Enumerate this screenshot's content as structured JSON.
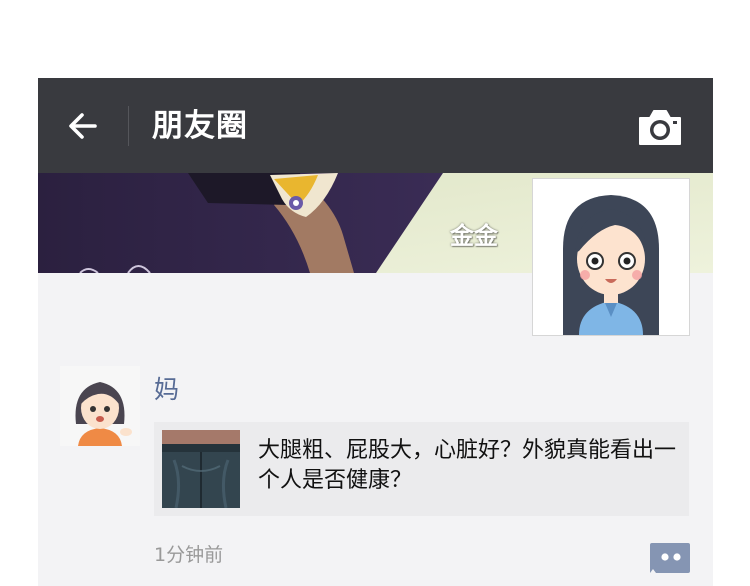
{
  "navbar": {
    "title": "朋友圈",
    "back_icon": "back-arrow-icon",
    "camera_icon": "camera-icon"
  },
  "cover": {
    "name": "金金"
  },
  "post": {
    "author": "妈",
    "link_title": "大腿粗、屁股大，心脏好？外貌真能看出一个人是否健康？",
    "time": "1分钟前",
    "comment_icon": "comment-icon"
  },
  "colors": {
    "navbar_bg": "#393a3f",
    "name_link": "#576b95",
    "page_bg": "#f3f3f5",
    "card_bg": "#ebebed"
  }
}
